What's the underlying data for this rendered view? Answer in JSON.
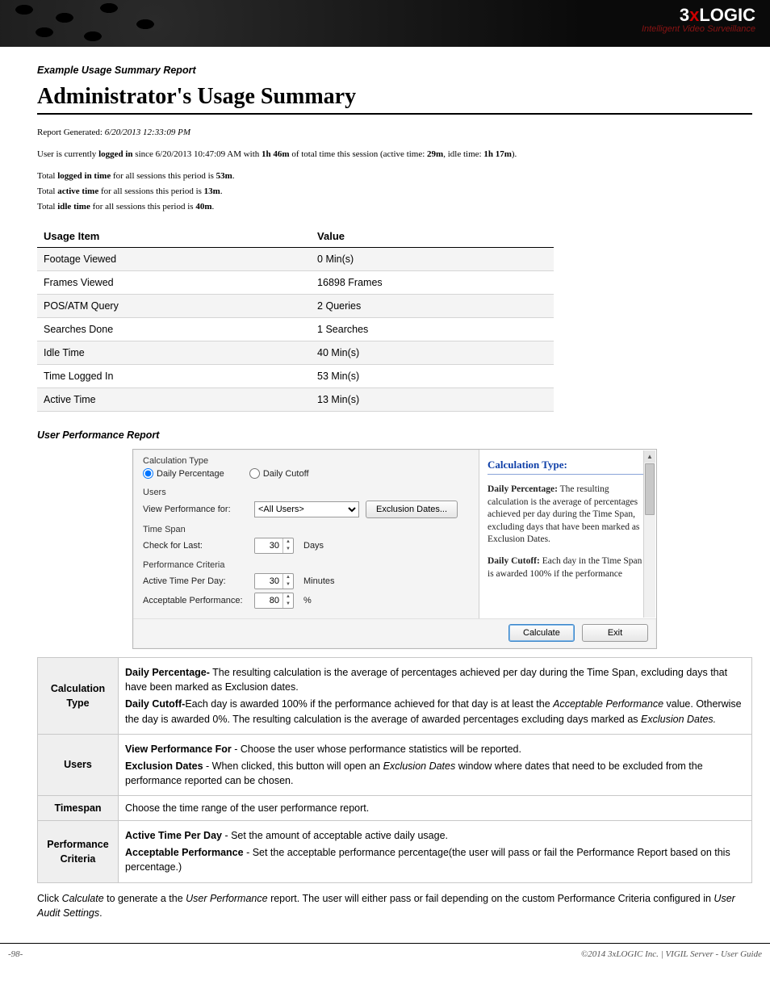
{
  "brand": {
    "logo_pre": "3",
    "logo_mid": "x",
    "logo_post": "LOGIC",
    "tagline": "Intelligent Video Surveillance"
  },
  "section1_title": "Example Usage Summary Report",
  "report_title": "Administrator's Usage Summary",
  "report_generated_label": "Report Generated: ",
  "report_generated_value": "6/20/2013 12:33:09 PM",
  "line_user_pre": "User is currently ",
  "line_user_logged": "logged in",
  "line_user_mid": " since 6/20/2013 10:47:09 AM with ",
  "line_user_total": "1h 46m",
  "line_user_mid2": " of total time this session (active time: ",
  "line_user_active": "29m",
  "line_user_mid3": ", idle time: ",
  "line_user_idle": "1h 17m",
  "line_user_end": ").",
  "tot1_pre": "Total ",
  "tot1_b": "logged in time",
  "tot1_post": " for all sessions this period is ",
  "tot1_v": "53m",
  "dot": ".",
  "tot2_b": "active time",
  "tot2_v": "13m",
  "tot3_b": "idle time",
  "tot3_v": "40m",
  "usage_headers": {
    "item": "Usage Item",
    "value": "Value"
  },
  "usage_rows": [
    {
      "item": "Footage Viewed",
      "value": "0 Min(s)"
    },
    {
      "item": "Frames Viewed",
      "value": "16898 Frames"
    },
    {
      "item": "POS/ATM Query",
      "value": "2 Queries"
    },
    {
      "item": "Searches Done",
      "value": "1 Searches"
    },
    {
      "item": "Idle Time",
      "value": "40 Min(s)"
    },
    {
      "item": "Time Logged In",
      "value": "53 Min(s)"
    },
    {
      "item": "Active Time",
      "value": "13 Min(s)"
    }
  ],
  "section2_title": "User Performance Report",
  "dlg": {
    "calc_type": "Calculation Type",
    "daily_pct": "Daily Percentage",
    "daily_cut": "Daily Cutoff",
    "users": "Users",
    "view_perf_for": "View Performance for:",
    "all_users": "<All Users>",
    "exclusion_btn": "Exclusion Dates...",
    "timespan": "Time Span",
    "check_last": "Check for Last:",
    "timespan_val": "30",
    "days": "Days",
    "perf_crit": "Performance Criteria",
    "active_per_day": "Active Time Per Day:",
    "active_val": "30",
    "minutes": "Minutes",
    "accept_perf": "Acceptable Performance:",
    "accept_val": "80",
    "pct": "%",
    "calculate": "Calculate",
    "exit": "Exit"
  },
  "help": {
    "title": "Calculation Type:",
    "dp_label": "Daily Percentage:",
    "dp_body": " The resulting calculation is the average of percentages achieved per day during the Time Span, excluding days that have been marked as Exclusion Dates.",
    "dc_label": "Daily Cutoff:",
    "dc_body": " Each day in the Time Span is awarded 100% if the performance"
  },
  "defs": {
    "calc": "Calculation Type",
    "calc_dp_b": "Daily Percentage-",
    "calc_dp": " The resulting calculation is the average of percentages achieved per day during the Time Span, excluding days that have been marked as Exclusion dates.",
    "calc_dc_b": "Daily Cutoff-",
    "calc_dc_1": "Each day is awarded 100% if the performance achieved for that day is at least the ",
    "calc_dc_i": "Acceptable Performance",
    "calc_dc_2": " value. Otherwise the day is awarded 0%. The resulting calculation is the average of awarded percentages excluding days marked as ",
    "calc_dc_i2": "Exclusion Dates.",
    "users": "Users",
    "users_vp_b": "View Performance For",
    "users_vp": " - Choose the user whose performance statistics will be reported.",
    "users_ex_b": "Exclusion Dates",
    "users_ex_1": " - When clicked, this button will open an ",
    "users_ex_i": "Exclusion Dates",
    "users_ex_2": " window where dates that need to be excluded from the performance reported can be chosen.",
    "timespan": "Timespan",
    "timespan_body": "Choose the time range of the user performance report.",
    "perf": "Performance Criteria",
    "perf_at_b": "Active Time Per Day",
    "perf_at": " - Set the amount of acceptable active daily usage.",
    "perf_ap_b": "Acceptable Performance",
    "perf_ap": " - Set the acceptable performance percentage(the user will pass or fail the Performance Report based on this percentage.)"
  },
  "closing_pre": "Click ",
  "closing_i1": "Calculate",
  "closing_mid": " to generate a the ",
  "closing_i2": "User Performance",
  "closing_mid2": " report. The user will either pass or fail depending on the custom Performance Criteria configured in ",
  "closing_i3": "User Audit Settings",
  "footer": {
    "page": "-98-",
    "right": "©2014 3xLOGIC Inc. | VIGIL Server - User Guide"
  }
}
